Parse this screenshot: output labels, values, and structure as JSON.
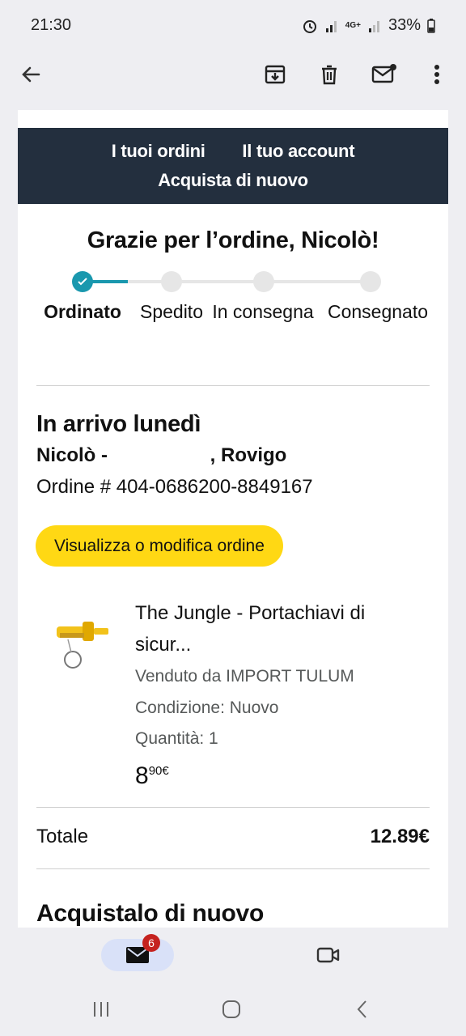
{
  "status": {
    "time": "21:30",
    "battery": "33%",
    "network": "4G+"
  },
  "email_header": {
    "nav_links": [
      "I tuoi ordini",
      "Il tuo account"
    ],
    "buy_again_link": "Acquista di nuovo"
  },
  "order": {
    "thanks": "Grazie per l’ordine, Nicolò!",
    "steps": [
      {
        "label": "Ordinato",
        "active": true
      },
      {
        "label": "Spedito",
        "active": false
      },
      {
        "label": "In consegna",
        "active": false
      },
      {
        "label": "Consegnato",
        "active": false
      }
    ],
    "arrival": "In arrivo lunedì",
    "address_name": "Nicolò - ",
    "address_city": ", Rovigo",
    "order_number": "Ordine # 404-0686200-8849167",
    "view_button": "Visualizza o modifica ordine"
  },
  "product": {
    "title": "The Jungle - Portachiavi di sicur...",
    "seller": "Venduto da IMPORT TULUM",
    "condition": "Condizione: Nuovo",
    "quantity": "Quantità: 1",
    "price_int": "8",
    "price_dec": "90€"
  },
  "totals": {
    "label": "Totale",
    "value": "12.89€"
  },
  "buy_again_heading": "Acquistalo di nuovo",
  "bottom": {
    "mail_badge": "6"
  },
  "colors": {
    "nav_bg": "#232f3e",
    "button_yellow": "#ffd814",
    "progress_teal": "#1a98ae"
  }
}
